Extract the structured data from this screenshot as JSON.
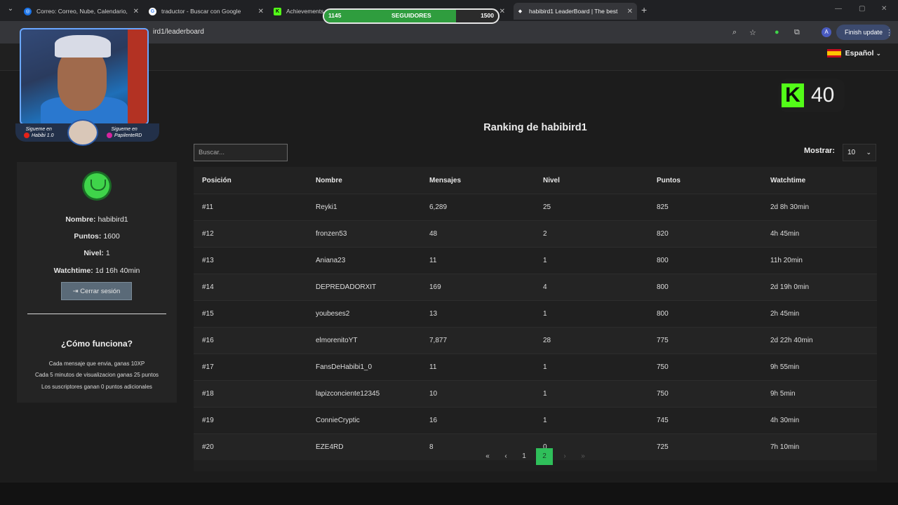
{
  "browser": {
    "tabs": [
      {
        "label": "Correo: Correo, Nube, Calendario,",
        "icon": "outlook-icon",
        "color": "#1a73e8"
      },
      {
        "label": "traductor - Buscar con Google",
        "icon": "google-icon",
        "color": "#ffffff"
      },
      {
        "label": "Achievements",
        "icon": "kick-icon",
        "color": "#53fc18"
      },
      {
        "label": "habibird1 LeaderBoard | The best",
        "icon": "diamond-icon",
        "color": "#ffffff"
      }
    ],
    "url": "ird1/leaderboard",
    "finish_update": "Finish update"
  },
  "overlay": {
    "followers_current": "1145",
    "followers_label": "SEGUIDORES",
    "followers_goal": "1500",
    "followers_progress": 0.76,
    "social_youtube_top": "Sigueme en",
    "social_youtube_name": "Habibi 1.0",
    "social_instagram_top": "Sigueme en",
    "social_instagram_name": "PapilenteRD",
    "kick_count": "40"
  },
  "header": {
    "language": "Español"
  },
  "leaderboard": {
    "title": "Ranking de habibird1",
    "search_placeholder": "Buscar...",
    "show_label": "Mostrar:",
    "show_value": "10",
    "columns": [
      "Posición",
      "Nombre",
      "Mensajes",
      "Nivel",
      "Puntos",
      "Watchtime"
    ],
    "rows": [
      [
        "#11",
        "Reyki1",
        "6,289",
        "25",
        "825",
        "2d 8h 30min"
      ],
      [
        "#12",
        "fronzen53",
        "48",
        "2",
        "820",
        "4h 45min"
      ],
      [
        "#13",
        "Aniana23",
        "11",
        "1",
        "800",
        "11h 20min"
      ],
      [
        "#14",
        "DEPREDADORXIT",
        "169",
        "4",
        "800",
        "2d 19h 0min"
      ],
      [
        "#15",
        "youbeses2",
        "13",
        "1",
        "800",
        "2h 45min"
      ],
      [
        "#16",
        "elmorenitoYT",
        "7,877",
        "28",
        "775",
        "2d 22h 40min"
      ],
      [
        "#17",
        "FansDeHabibi1_0",
        "11",
        "1",
        "750",
        "9h 55min"
      ],
      [
        "#18",
        "lapizconciente12345",
        "10",
        "1",
        "750",
        "9h 5min"
      ],
      [
        "#19",
        "ConnieCryptic",
        "16",
        "1",
        "745",
        "4h 30min"
      ],
      [
        "#20",
        "EZE4RD",
        "8",
        "0",
        "725",
        "7h 10min"
      ]
    ],
    "pagination": {
      "first": "«",
      "prev": "‹",
      "pages": [
        "1",
        "2"
      ],
      "current": "2",
      "next": "›",
      "last": "»"
    }
  },
  "profile": {
    "name_label": "Nombre:",
    "name_value": "habibird1",
    "points_label": "Puntos:",
    "points_value": "1600",
    "level_label": "Nivel:",
    "level_value": "1",
    "watchtime_label": "Watchtime:",
    "watchtime_value": "1d 16h 40min",
    "logout_label": "Cerrar sesión",
    "how_title": "¿Cómo funciona?",
    "rules": [
      "Cada mensaje que envia, ganas 10XP",
      "Cada 5 minutos de visualizacion ganas 25 puntos",
      "Los suscriptores ganan 0 puntos adicionales"
    ]
  },
  "colors": {
    "accent_green": "#2fbf5a",
    "kick_green": "#53fc18",
    "background": "#1c1c1c"
  }
}
